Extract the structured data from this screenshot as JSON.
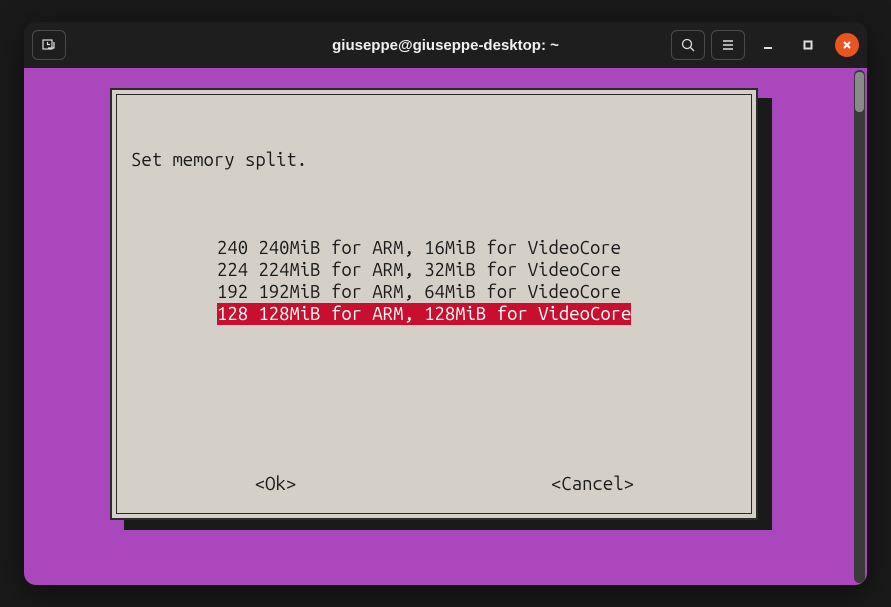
{
  "window": {
    "title": "giuseppe@giuseppe-desktop: ~"
  },
  "dialog": {
    "title": "Set memory split.",
    "options": [
      {
        "value": "240",
        "label": "240MiB for ARM, 16MiB for VideoCore",
        "selected": false
      },
      {
        "value": "224",
        "label": "224MiB for ARM, 32MiB for VideoCore",
        "selected": false
      },
      {
        "value": "192",
        "label": "192MiB for ARM, 64MiB for VideoCore",
        "selected": false
      },
      {
        "value": "128",
        "label": "128MiB for ARM, 128MiB for VideoCore",
        "selected": true
      }
    ],
    "ok_label": "<Ok>",
    "cancel_label": "<Cancel>"
  }
}
